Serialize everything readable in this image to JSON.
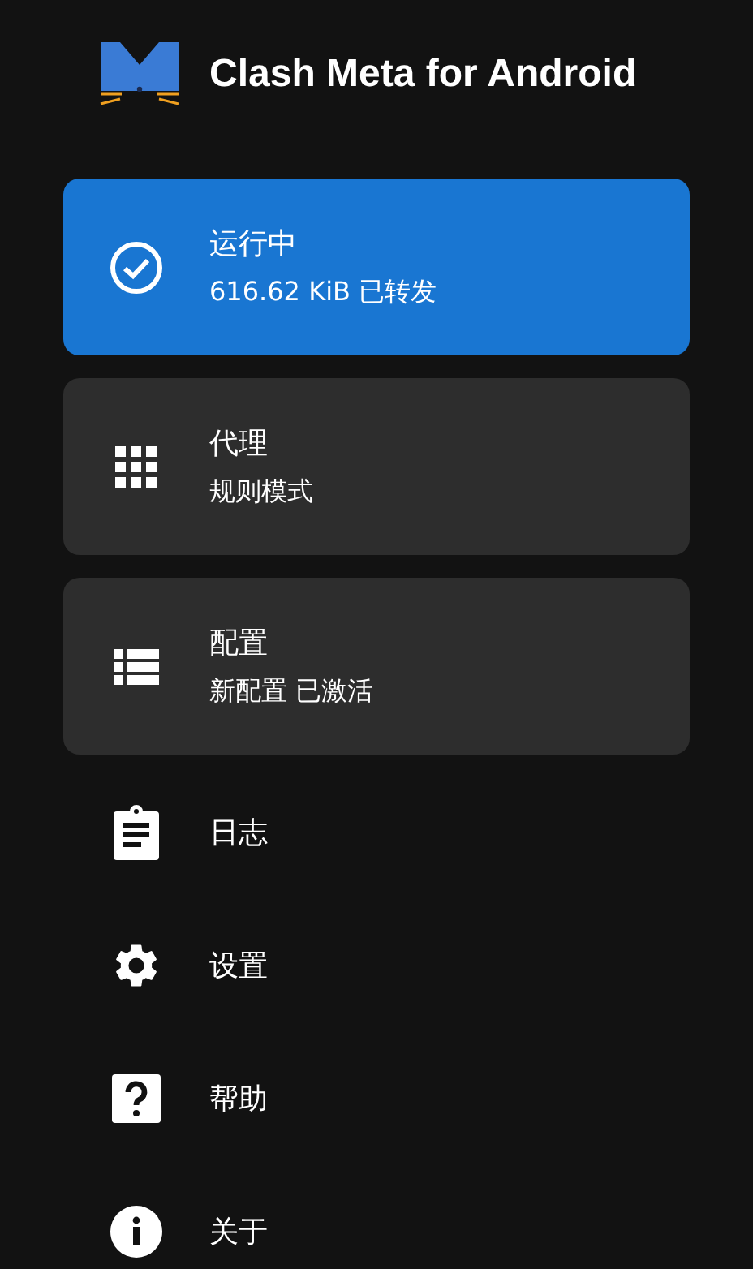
{
  "app": {
    "title": "Clash Meta for Android"
  },
  "cards": [
    {
      "kind": "running",
      "active": true,
      "title": "运行中",
      "subtitle": "616.62 KiB 已转发"
    },
    {
      "kind": "proxy",
      "active": false,
      "title": "代理",
      "subtitle": "规则模式"
    },
    {
      "kind": "profile",
      "active": false,
      "title": "配置",
      "subtitle": "新配置 已激活"
    }
  ],
  "menu": [
    {
      "kind": "logs",
      "label": "日志"
    },
    {
      "kind": "settings",
      "label": "设置"
    },
    {
      "kind": "help",
      "label": "帮助"
    },
    {
      "kind": "about",
      "label": "关于"
    }
  ]
}
